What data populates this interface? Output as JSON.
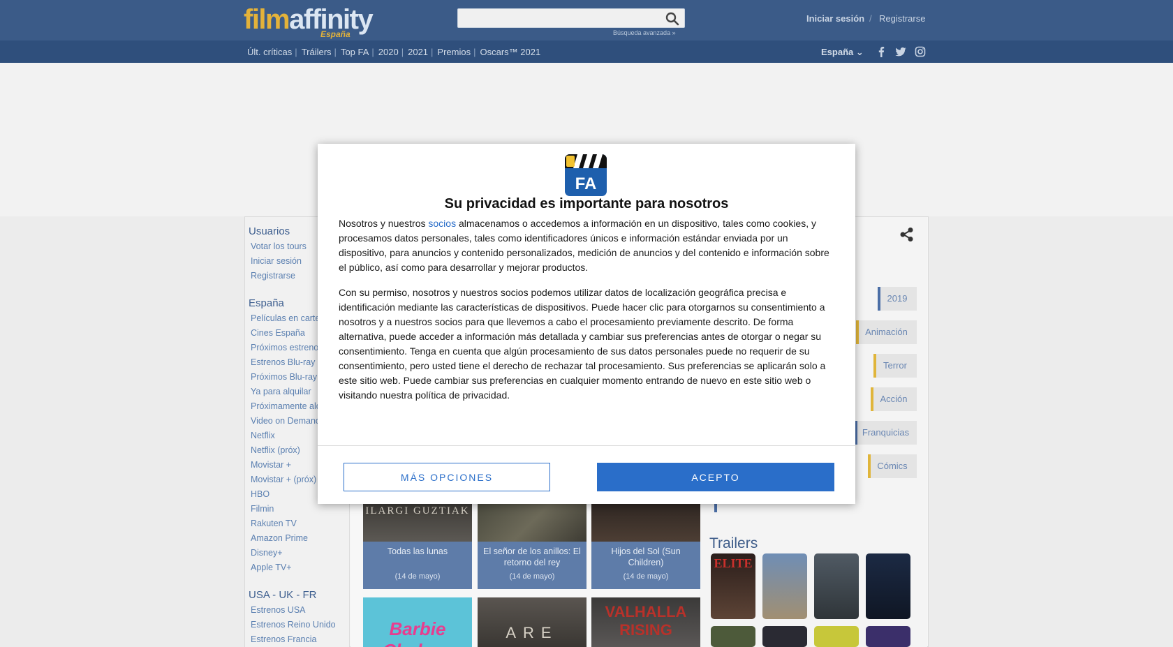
{
  "header": {
    "logo_main": "film",
    "logo_accent": "affinity",
    "logo_sub": "España",
    "search_placeholder": "",
    "advanced_search": "Búsqueda avanzada »",
    "login": "Iniciar sesión",
    "separator": "/",
    "register": "Registrarse"
  },
  "nav": {
    "items": [
      "Últ. críticas",
      "Tráilers",
      "Top FA",
      "2020",
      "2021",
      "Premios",
      "Oscars™ 2021"
    ],
    "country": "España",
    "social_icons": [
      "facebook-icon",
      "twitter-icon",
      "instagram-icon"
    ]
  },
  "sidebar": {
    "sections": [
      {
        "title": "Usuarios",
        "links": [
          "Votar los tours",
          "Iniciar sesión",
          "Registrarse"
        ]
      },
      {
        "title": "España",
        "links": [
          "Películas en cartelera",
          "Cines España",
          "Próximos estrenos",
          "Estrenos Blu-ray",
          "Próximos Blu-ray",
          "Ya para alquilar",
          "Próximamente alquiler",
          "Video on Demand",
          "Netflix",
          "Netflix (próx)",
          "Movistar +",
          "Movistar + (próx)",
          "HBO",
          "Filmin",
          "Rakuten TV",
          "Amazon Prime",
          "Disney+",
          "Apple TV+"
        ]
      },
      {
        "title": "USA - UK - FR",
        "links": [
          "Estrenos USA",
          "Estrenos Reino Unido",
          "Estrenos Francia"
        ]
      }
    ]
  },
  "tags": [
    "2019",
    "Animación",
    "Terror",
    "Acción",
    "Franquicias",
    "Cómics"
  ],
  "posters": [
    {
      "title": "Todas las lunas",
      "date": "(14 de mayo)",
      "overlay_text": "ILARGI GUZTIAK"
    },
    {
      "title": "El señor de los anillos: El retorno del rey",
      "date": "(14 de mayo)",
      "overlay_text": ""
    },
    {
      "title": "Hijos del Sol (Sun Children)",
      "date": "(14 de mayo)",
      "overlay_text": ""
    }
  ],
  "posters_row2": [
    "Barbie Chelsea",
    "ARE",
    "VALHALLA RISING"
  ],
  "trailers": {
    "title": "Trailers",
    "row1": [
      "ELITE",
      "",
      "",
      ""
    ]
  },
  "modal": {
    "title": "Su privacidad es importante para nosotros",
    "logo_text": "FA",
    "p1_before": "Nosotros y nuestros ",
    "p1_link": "socios",
    "p1_after": " almacenamos o accedemos a información en un dispositivo, tales como cookies, y procesamos datos personales, tales como identificadores únicos e información estándar enviada por un dispositivo, para anuncios y contenido personalizados, medición de anuncios y del contenido e información sobre el público, así como para desarrollar y mejorar productos.",
    "p2": "Con su permiso, nosotros y nuestros socios podemos utilizar datos de localización geográfica precisa e identificación mediante las características de dispositivos. Puede hacer clic para otorgarnos su consentimiento a nosotros y a nuestros socios para que llevemos a cabo el procesamiento previamente descrito. De forma alternativa, puede acceder a información más detallada y cambiar sus preferencias antes de otorgar o negar su consentimiento. Tenga en cuenta que algún procesamiento de sus datos personales puede no requerir de su consentimiento, pero usted tiene el derecho de rechazar tal procesamiento. Sus preferencias se aplicarán solo a este sitio web. Puede cambiar sus preferencias en cualquier momento entrando de nuevo en este sitio web o visitando nuestra política de privacidad.",
    "more_options": "MÁS OPCIONES",
    "accept": "ACEPTO"
  },
  "colors": {
    "header_bg": "#3b5b88",
    "nav_bg": "#2f4f7c",
    "logo_accent": "#e3b23a",
    "button_blue": "#2a6ec9"
  }
}
